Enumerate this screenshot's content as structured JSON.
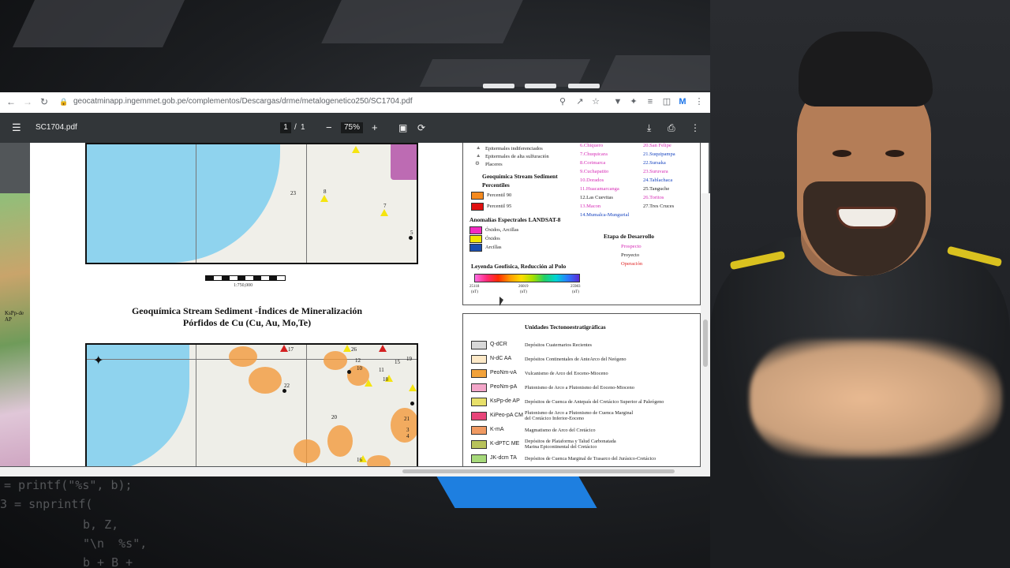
{
  "browser": {
    "url": "geocatminapp.ingemmet.gob.pe/complementos/Descargas/drme/metalogenetico250/SC1704.pdf"
  },
  "pdf_toolbar": {
    "filename": "SC1704.pdf",
    "page_current": "1",
    "page_separator": "/",
    "page_total": "1",
    "zoom": "75%"
  },
  "map_top": {
    "labels": [
      "23",
      "7",
      "8",
      "5"
    ],
    "scale_text": "1:750,000"
  },
  "section_title_line1": "Geoquímica Stream Sediment -Índices de Mineralización",
  "section_title_line2": "Pórfidos de Cu (Cu, Au, Mo,Te)",
  "map_bottom": {
    "labels": [
      "17",
      "26",
      "19",
      "12",
      "10",
      "11",
      "18",
      "15",
      "22",
      "20",
      "21",
      "3",
      "4",
      "16"
    ]
  },
  "left_map_label": "KsPp-de AP",
  "legend_top": {
    "symbols": [
      "Epitermales indiferenciados",
      "Epitermales de alta sulfuración",
      "Placeres"
    ],
    "geochem_title": "Geoquímica Stream Sediment",
    "percentiles_title": "Percentiles",
    "percentil_90": "Percentil 90",
    "percentil_95": "Percentil 95",
    "spectral_title": "Anomalías Espectrales LANDSAT-8",
    "spectral_items": [
      "Óxidos, Arcillas",
      "Óxidos",
      "Arcillas"
    ],
    "geophys_title": "Leyenda Geofísica, Reducción al Polo",
    "geophys_ticks": [
      "25118",
      "(nT)",
      "26019",
      "(nT)",
      "25983",
      "(nT)"
    ],
    "deposits_col1": [
      "6.Chiquero",
      "7.Chuquicara",
      "8.Corimarca",
      "9.Cuchapatito",
      "10.Dorados",
      "11.Huacamarcanga",
      "12.Las Cuevitas",
      "13.Macon",
      "14.Mumalca-Mungurial"
    ],
    "deposits_col2": [
      "20.San Felipe",
      "21.Suquipampa",
      "22.Sursaka",
      "23.Suruvara",
      "24.Tablachaca",
      "25.Tanguche",
      "26.Toritos",
      "27.Tres Cruces"
    ],
    "stage_title": "Etapa de Desarrollo",
    "stage_items": [
      "Prospecto",
      "Proyecto",
      "Operación"
    ],
    "colors": {
      "p90": "#f58a1f",
      "p95": "#e01010",
      "oxarc": "#f22bc1",
      "ox": "#f2e600",
      "arc": "#1a4fb0"
    }
  },
  "legend_tecto": {
    "title": "Unidades Tectonoestratigráficas",
    "rows": [
      {
        "code": "Q-dCR",
        "desc": "Depósitos Cuaternarios Recientes",
        "color": "#d8d8d8"
      },
      {
        "code": "N-dC AA",
        "desc": "Depósitos Continentales de AnteArco del Neógeno",
        "color": "#fde9c7"
      },
      {
        "code": "PeoNm-vA",
        "desc": "Vulcanismo de Arco del Eoceno-Mioceno",
        "color": "#f2a23a"
      },
      {
        "code": "PeoNm-pA",
        "desc": "Plutonismo de Arco a Plutonismo del Eoceno-Mioceno",
        "color": "#f3a6c9"
      },
      {
        "code": "KsPp-de AP",
        "desc": "Depósitos de Cuenca de Antepaís del Cretácico Superior al Paleógeno",
        "color": "#e8e06a"
      },
      {
        "code": "KiPeo-pA CM",
        "desc": "Plutonismo de Arco a Plutonismo de Cuenca Marginal del Cretácico Inferior-Eoceno",
        "color": "#e8457a"
      },
      {
        "code": "K-mA",
        "desc": "Magmatismo de Arco del Cretácico",
        "color": "#f09a62"
      },
      {
        "code": "K-dPTC ME",
        "desc": "Depósitos de Plataforma y Talud Carbonatada Marina Epicontinental del Cretácico",
        "color": "#b8c25a"
      },
      {
        "code": "JK-dcm TA",
        "desc": "Depósitos de Cuenca Marginal de Trasarco del Jurásico-Cretácico",
        "color": "#a6d97a"
      }
    ]
  },
  "background_code": [
    "= printf(\"%s\", b);",
    "3 = snprintf(",
    "b, Z,",
    "\"\\n  %s\",",
    "b + B +"
  ]
}
